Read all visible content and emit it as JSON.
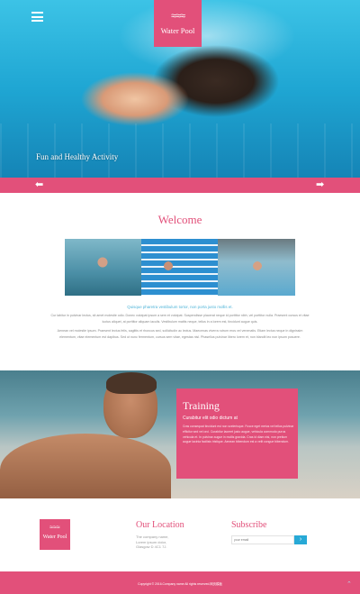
{
  "header": {
    "logo_waves": "≈≈≈",
    "logo_text": "Water Pool",
    "caption": "Fun and Healthy Activity"
  },
  "slider": {
    "prev_arrow": "⬅",
    "next_arrow": "➡"
  },
  "welcome": {
    "title": "Welcome",
    "subheading": "Quisque pharetra vestibulum tortor, non porta justo mollis et.",
    "paragraph1": "Cur labitur in pulvinar lectus, sit amet molestie odio. Donec volutpat ipsum a sem et volutpat. Suspendisse placerat neque id porttitor nibh, vel porttitor nulla. Praesent cursus et vitae luctus aliquet, at porttitor aliquam iaculis. Vestibulum mattis neque, tellus in a lorem est, tincidunt augue quis.",
    "paragraph2": "Aenean vel molestie ipsum. Praesent lectus felis, sagittis et rhoncus sed, sollicitudin ac lectus. Maecenas viverra rutrum eros vel venenatis. Etiam lectus neque in dignissim elementum, vitae elementum est dapibus. Sed ut nunc fermentum, cursus sem vitae, egestas nisl. Phasellus pulvinar libero lorem et, non blandit leo non ipsum posuere."
  },
  "training": {
    "title": "Training",
    "subtitle": "Curabitur elit odio dictum at",
    "text": "Cras consequat tincidunt est non scelerisque. Fusce eget metus vel tellus pulvinar efficitur sed vel orci. Curabitur laoreet justo augue, vehicula commodo purus vehicula et. In pulvinar augue in mollis gravida. Cras id diam nisi, non pretium augue lacinia facilisis tristique. Aenean bibendum est a velit congue bibendum."
  },
  "footer": {
    "logo_waves": "≈≈≈",
    "logo_text": "Water Pool",
    "location_title": "Our Location",
    "location_line1": "The company name,",
    "location_line2": "Lorem ipsum dolor,",
    "location_line3": "Glasgow D 4C1 7J.",
    "subscribe_title": "Subscribe",
    "subscribe_placeholder": "your email",
    "subscribe_button": "›",
    "copyright": "Copyright © 2016.Company name All rights reserved.网页模板",
    "back_to_top": "⌃"
  },
  "colors": {
    "accent": "#e2507a",
    "button": "#27a9d6",
    "subheading": "#4fb4d8"
  }
}
